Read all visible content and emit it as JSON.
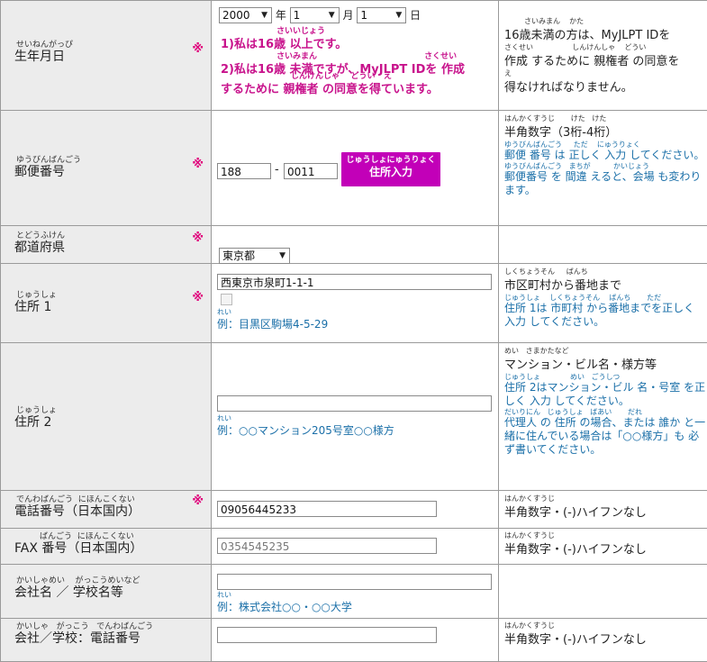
{
  "rows": {
    "birth": {
      "ruby": "せいねんがっぴ",
      "label": "生年月日",
      "required": "※",
      "year": "2000",
      "year_unit": "年",
      "month": "1",
      "month_unit": "月",
      "day": "1",
      "day_unit": "日",
      "opt1_ruby": "さいいじょう",
      "opt1": "1)私は16歳 以上です。",
      "opt2_ruby": "さいみまん                                      さくせい",
      "opt2a": "2)私は16歳 未満ですが、MyJLPT IDを 作成",
      "opt2b_ruby": "しんけんしゃ    どうい   え",
      "opt2b": "するために 親権者 の同意を得ています。",
      "note_ruby1": "さいみまん    かた",
      "note1": "16歳未満の方は、MyJLPT IDを",
      "note_ruby2": "さくせい                 しんけんしゃ    どうい",
      "note2": "作成 するために 親権者 の同意を",
      "note_ruby3": "え",
      "note3": "得なければなりません。"
    },
    "postal": {
      "ruby": "ゆうびんばんごう",
      "label": "郵便番号",
      "required": "※",
      "zip1": "188",
      "dash": "-",
      "zip2": "0011",
      "button_ruby": "じゅうしょにゅうりょく",
      "button_label": "住所入力",
      "note_ruby": "はんかくすうじ       けた   けた",
      "note": "半角数字（3桁-4桁）",
      "hint1_ruby": "ゆうびんばんごう     ただ    にゅうりょく",
      "hint1": "郵便 番号 は 正しく 入力 してください。",
      "hint2_ruby": "ゆうびんばんごう   まちが          かいじょう",
      "hint2": "郵便番号 を 間違 えると、会場 も変わります。"
    },
    "prefecture": {
      "ruby": "とどうふけん",
      "label": "都道府県",
      "required": "※",
      "value": "東京都"
    },
    "address1": {
      "ruby": "じゅうしょ",
      "label": "住所 1",
      "required": "※",
      "value": "西東京市泉町1-1-1",
      "ex_ruby": "れい",
      "example": "例：目黒区駒場4-5-29",
      "note_ruby": "しくちょうそん     ばんち",
      "note": "市区町村から番地まで",
      "hint_ruby": "じゅうしょ    しくちょうそん    ばんち       ただ",
      "hint": "住所 1は 市町村 から番地までを正しく 入力 してください。"
    },
    "address2": {
      "ruby": "じゅうしょ",
      "label": "住所 2",
      "value": "",
      "ex_ruby": "れい",
      "example": "例：○○マンション205号室○○様方",
      "note_ruby": "めい   さまかたなど",
      "note": "マンション・ビル名・様方等",
      "hint1_ruby": "じゅうしょ             めい   ごうしつ",
      "hint1": "住所 2はマンション・ビル 名・号室 を正しく 入力 してください。",
      "hint2_ruby": "だいりにん   じゅうしょ   ばあい       だれ",
      "hint2": "代理人 の 住所 の場合、または 誰か と一緒に住んでいる場合は「○○様方」も 必 ず書いてください。"
    },
    "phone": {
      "ruby": "でんわばんごう  にほんこくない",
      "label": "電話番号（日本国内）",
      "required": "※",
      "value": "09056445233",
      "note_ruby": "はんかくすうじ",
      "note": "半角数字・(-)ハイフンなし"
    },
    "fax": {
      "ruby": "ばんごう  にほんこくない",
      "label": "FAX 番号（日本国内）",
      "placeholder": "0354545235",
      "note_ruby": "はんかくすうじ",
      "note": "半角数字・(-)ハイフンなし"
    },
    "company": {
      "ruby": "かいしゃめい    がっこうめいなど",
      "label": "会社名 ／ 学校名等",
      "value": "",
      "ex_ruby": "れい",
      "example": "例：株式会社○○・○○大学"
    },
    "company_phone": {
      "ruby": "かいしゃ   がっこう   でんわばんごう",
      "label": "会社／学校：電話番号",
      "value": "",
      "note_ruby": "はんかくすうじ",
      "note": "半角数字・(-)ハイフンなし"
    }
  }
}
